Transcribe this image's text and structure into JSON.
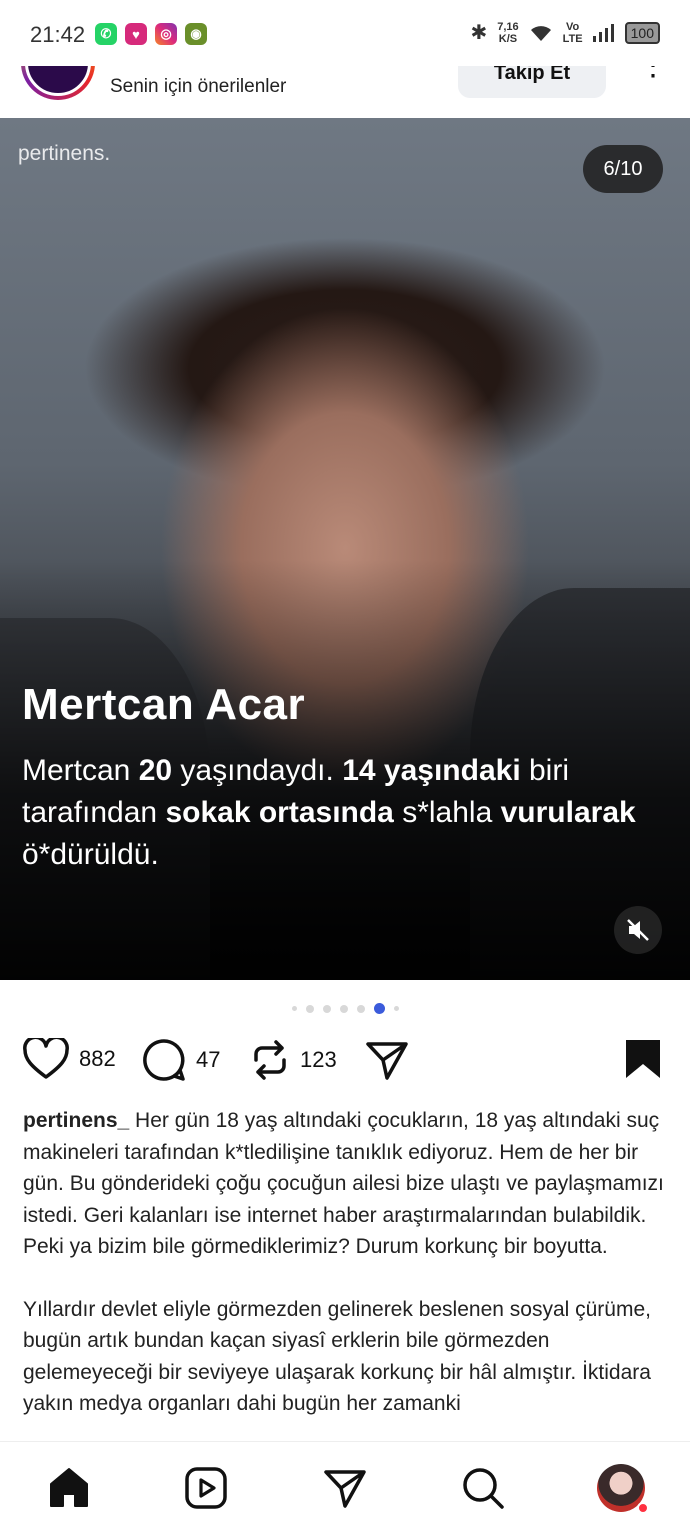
{
  "status_bar": {
    "time": "21:42",
    "net_speed_value": "7,16",
    "net_speed_unit": "K/S",
    "volte_top": "Vo",
    "volte_bottom": "LTE",
    "battery": "100",
    "apps": [
      "whatsapp-icon",
      "notification-app-icon",
      "instagram-icon",
      "game-app-icon"
    ]
  },
  "post_header": {
    "subtitle": "Senin için önerilenler",
    "follow_label": "Takip Et",
    "more_label": "⋮"
  },
  "post_media": {
    "watermark": "pertinens.",
    "counter": "6/10",
    "title": "Mertcan Acar",
    "overlay_text": {
      "t1": "Mertcan ",
      "b1": "20",
      "t2": " yaşındaydı. ",
      "b2": "14 yaşındaki",
      "t3": " biri tarafından ",
      "b3": "sokak ortasında",
      "t4": " s*lahla ",
      "b4": "vurularak",
      "t5": " ö*dürüldü."
    }
  },
  "carousel": {
    "total_dots": 7,
    "active_index": 5
  },
  "actions": {
    "likes": "882",
    "comments": "47",
    "reposts": "123"
  },
  "caption": {
    "username": "pertinens_",
    "para1": "Her gün 18 yaş altındaki çocukların, 18 yaş altındaki suç makineleri tarafından k*tledilişine tanıklık ediyoruz. Hem de her bir gün. Bu gönderideki çoğu çocuğun ailesi bize ulaştı ve paylaşmamızı istedi. Geri kalanları ise internet haber araştırmalarından bulabildik. Peki ya bizim bile görmediklerimiz? Durum korkunç bir boyutta.",
    "para2": "Yıllardır devlet eliyle görmezden gelinerek beslenen sosyal çürüme, bugün artık bundan kaçan siyasî erklerin bile görmezden gelemeyeceği bir seviyeye ulaşarak korkunç bir hâl almıştır. İktidara yakın medya organları dahi bugün her zamanki"
  },
  "colors": {
    "accent": "#3b5bdb",
    "notification": "#ff3040",
    "whatsapp": "#25d366",
    "instagram": "#dd2a7b"
  }
}
